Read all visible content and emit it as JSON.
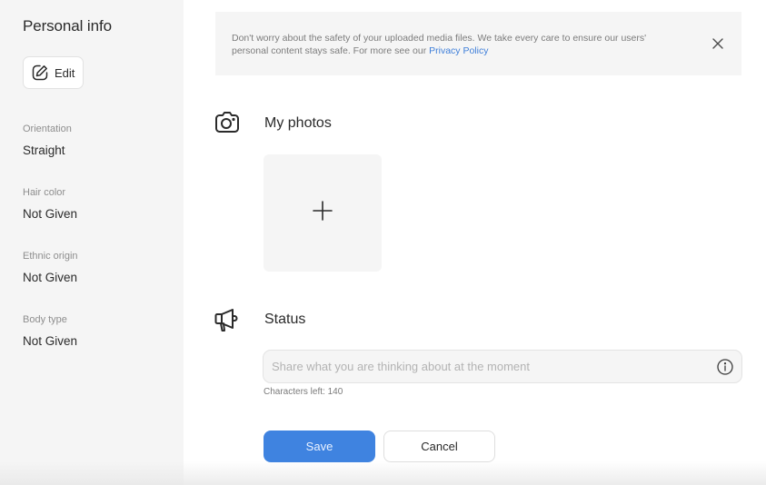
{
  "sidebar": {
    "title": "Personal info",
    "edit_label": "Edit",
    "fields": [
      {
        "label": "Orientation",
        "value": "Straight"
      },
      {
        "label": "Hair color",
        "value": "Not Given"
      },
      {
        "label": "Ethnic origin",
        "value": "Not Given"
      },
      {
        "label": "Body type",
        "value": "Not Given"
      }
    ]
  },
  "banner": {
    "text": "Don't worry about the safety of your uploaded media files. We take every care to ensure our users' personal content stays safe. For more see our ",
    "link_label": "Privacy Policy",
    "close_icon": "close-icon"
  },
  "photos": {
    "title": "My photos",
    "icon": "camera-icon",
    "add_icon": "plus-icon"
  },
  "status": {
    "title": "Status",
    "icon": "megaphone-icon",
    "value": "",
    "placeholder": "Share what you are thinking about at the moment",
    "chars_left_text": "Characters left: 140",
    "info_icon": "info-icon"
  },
  "actions": {
    "save_label": "Save",
    "cancel_label": "Cancel"
  },
  "colors": {
    "accent": "#3f83e0",
    "link": "#3f7fd9",
    "panel_bg": "#f5f5f5"
  }
}
